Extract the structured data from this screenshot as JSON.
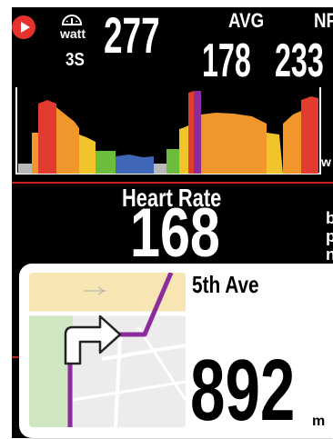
{
  "power": {
    "current_value": "277",
    "unit_icon_label": "watt",
    "interval": "3S",
    "avg_label": "AVG",
    "avg_value": "178",
    "np_label": "NP",
    "np_value": "233",
    "chart_icon": "power-zone-bar-chart"
  },
  "heart_rate": {
    "label": "Heart Rate",
    "value": "168",
    "side_partial": [
      "b",
      "p",
      "n"
    ]
  },
  "navigation": {
    "street": "5th Ave",
    "distance": "892",
    "distance_unit": "m",
    "turn_direction": "right",
    "turn_icon": "turn-right-arrow-icon"
  },
  "colors": {
    "brand_red": "#e5322d",
    "route_purple": "#8c2b9c",
    "zone_grey": "#b8b8b8",
    "zone_blue": "#3f67b5",
    "zone_green": "#6cbd3d",
    "zone_yellow": "#f1c42c",
    "zone_orange": "#f0962a",
    "zone_red": "#e23b2f"
  }
}
